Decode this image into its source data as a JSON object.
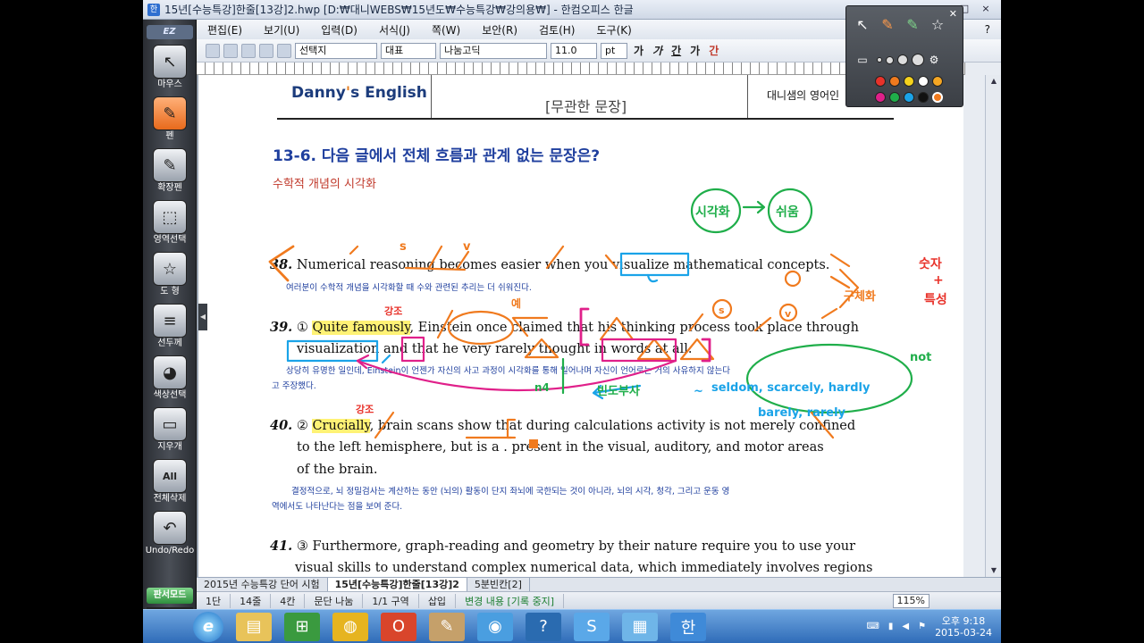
{
  "window": {
    "title": "15년[수능특강]한줄[13강]2.hwp  [D:₩대니WEBS₩15년도₩수능특강₩강의용₩] - 한컴오피스 한글",
    "buttons": [
      "_",
      "□",
      "×"
    ]
  },
  "menu": {
    "items": [
      "편집(E)",
      "보기(U)",
      "입력(D)",
      "서식(J)",
      "쪽(W)",
      "보안(R)",
      "검토(H)",
      "도구(K)"
    ],
    "help": "?"
  },
  "toolbar": {
    "style": "선택지",
    "lang": "대표",
    "font": "나눔고딕",
    "size": "11.0",
    "unit": "pt",
    "fmt": [
      "가",
      "가",
      "간",
      "가",
      "간"
    ]
  },
  "ez": {
    "logo": "EZ",
    "tools": [
      {
        "label": "마우스",
        "icon": "↖"
      },
      {
        "label": "펜",
        "icon": "✎"
      },
      {
        "label": "확장펜",
        "icon": "✎"
      },
      {
        "label": "영역선택",
        "icon": "⬚"
      },
      {
        "label": "도 형",
        "icon": "☆"
      },
      {
        "label": "선두께",
        "icon": "≡"
      },
      {
        "label": "색상선택",
        "icon": "◕"
      },
      {
        "label": "지우개",
        "icon": "▭"
      },
      {
        "label": "전체삭제",
        "icon": "All"
      },
      {
        "label": "Undo/Redo",
        "icon": "↶"
      }
    ],
    "mode": "판서모드",
    "close": "×"
  },
  "document": {
    "header": {
      "logo_prefix": "Danny",
      "logo_apos": "'",
      "logo_suffix": "s English",
      "subtitle": "[무관한 문장]",
      "right": "대니샘의 영어인"
    },
    "question": "13-6. 다음 글에서 전체 흐름과 관계 없는 문장은?",
    "subtitle": "수학적 개념의 시각화",
    "s38": {
      "num": "38.",
      "text": "Numerical reasoning becomes easier when you visualize mathematical concepts.",
      "trans": "여러분이 수학적 개념을 시각화할 때 수와 관련된 추리는 더 쉬워진다."
    },
    "s39": {
      "num": "39.",
      "marker": "①",
      "hl": "Quite famously",
      "line1_rest": ", Einstein once claimed that his thinking process took place through",
      "line2": "visualization and that he very rarely thought in words at all.",
      "trans1": "상당히 유명한 일인데, Einstein이 언젠가 자신의 사고 과정이 시각화를 통해 일어나며 자신이 언어로는 거의 사유하지 않는다",
      "trans2": "고 주장했다."
    },
    "s40": {
      "num": "40.",
      "marker": "②",
      "hl": "Crucially",
      "line1_rest": ", brain scans show that during calculations activity is not merely confined",
      "line2": "to the left hemisphere, but is a . present in the visual, auditory, and motor areas",
      "line3": "of the brain.",
      "trans1": "결정적으로, 뇌 정밀검사는 계산하는 동안 (뇌의) 활동이 단지 좌뇌에 국한되는 것이 아니라, 뇌의 시각, 청각, 그리고 운동 영",
      "trans2": "역에서도 나타난다는 점을 보여 준다."
    },
    "s41": {
      "num": "41.",
      "marker": "③",
      "line1": " Furthermore, graph-reading and geometry by their nature require you to use your",
      "line2": "visual skills to understand complex numerical data, which immediately involves regions"
    }
  },
  "annotations": {
    "a1": "시각화",
    "a2": "쉬움",
    "a3": "구체화",
    "a4": "숫자",
    "a5": "+",
    "a6": "특성",
    "a7": "강조",
    "a8": "강조",
    "a9": "예",
    "a10": "s",
    "a11": "v",
    "a12": "s",
    "a13": "v",
    "a14": "not",
    "a15": "n4",
    "a16": "빈도부사",
    "a17": "~",
    "a18": "seldom, scarcely, hardly",
    "a19": "barely, rarely"
  },
  "tabs": [
    "2015년 수능특강 단어 시험",
    "15년[수능특강]한줄[13강]2",
    "5분빈칸[2]"
  ],
  "status": {
    "items": [
      "1단",
      "14줄",
      "4칸",
      "문단 나눔",
      "1/1 구역",
      "삽입"
    ],
    "change": "변경 내용 [기록 중지]",
    "zoom": "115%"
  },
  "taskbar": {
    "time": "오후 9:18",
    "date": "2015-03-24"
  },
  "colors": {
    "orange": "#f07a1e",
    "blue": "#1aa3e8",
    "green": "#1fae4a",
    "magenta": "#e0208a",
    "navy": "#1f3f9e",
    "highlight": "#fff275"
  }
}
